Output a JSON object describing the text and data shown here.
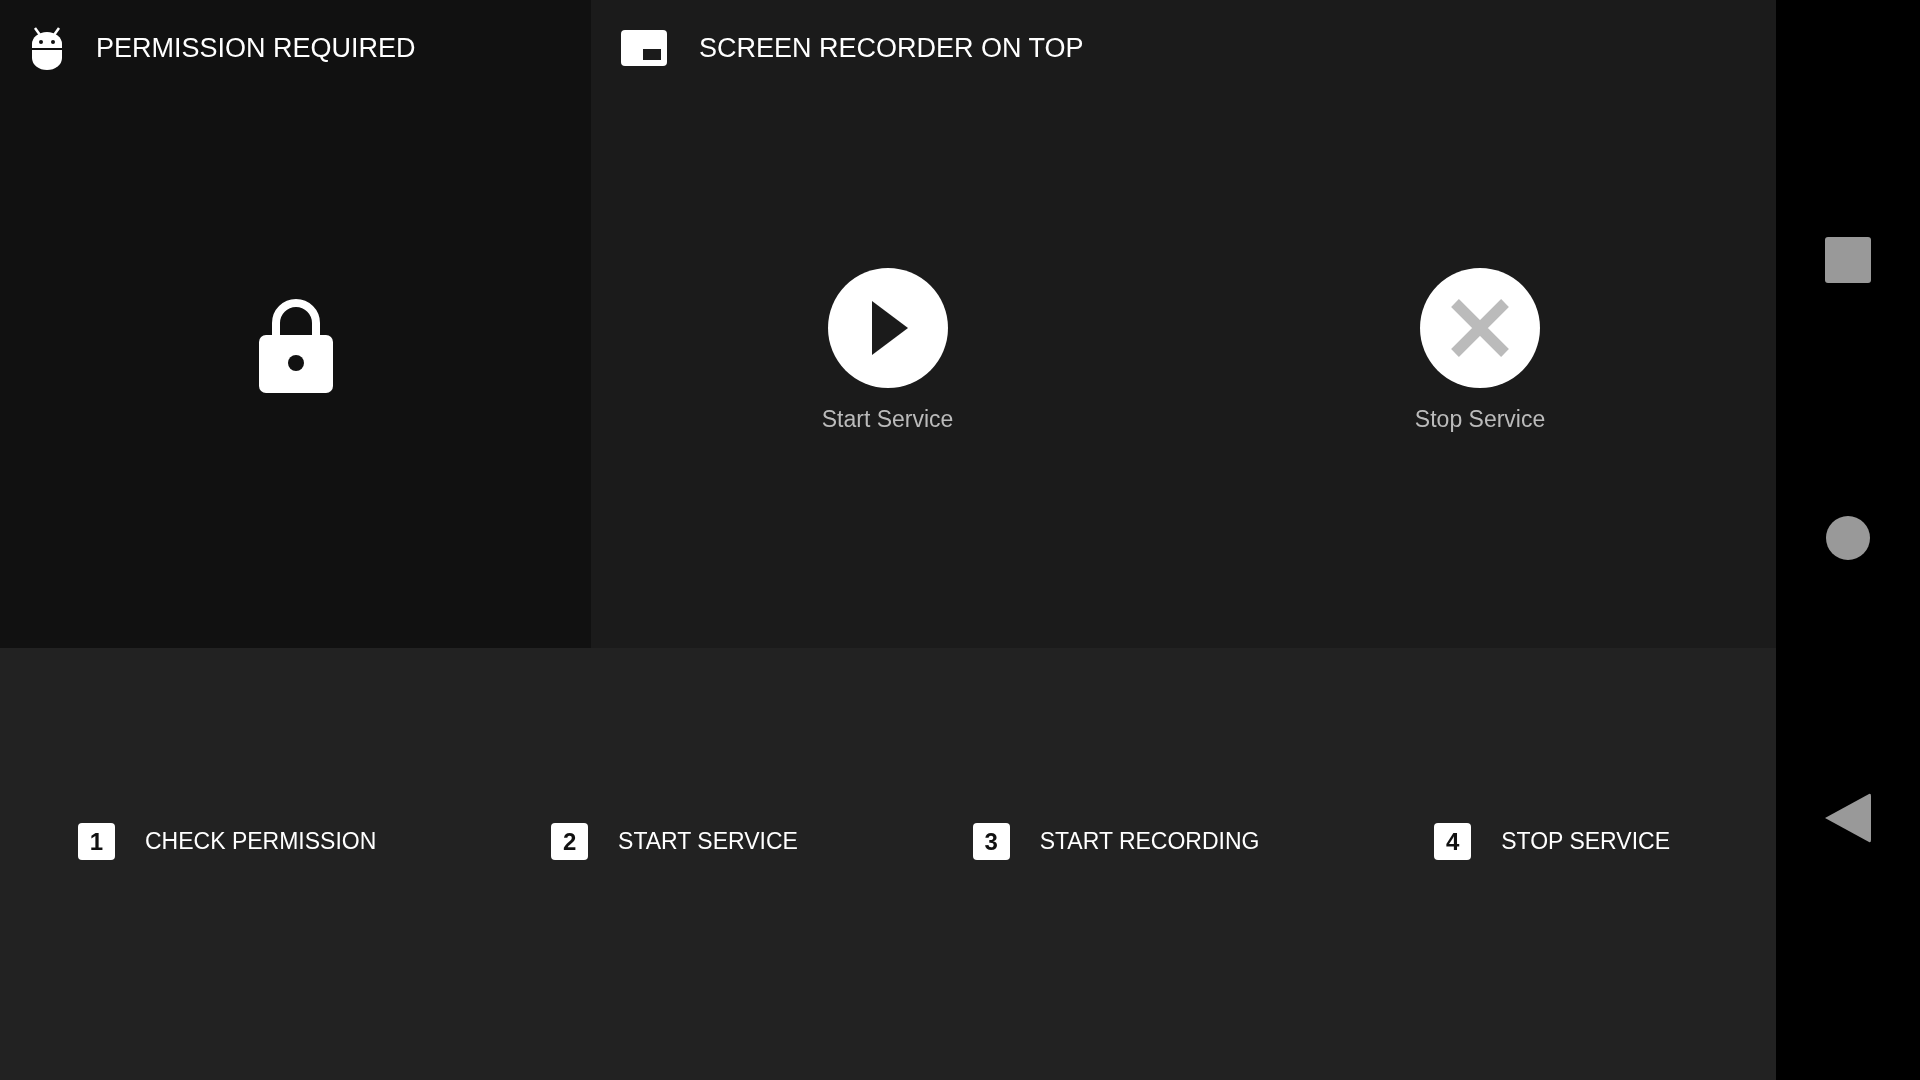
{
  "permission_panel": {
    "title": "PERMISSION REQUIRED",
    "locked": true
  },
  "recorder_panel": {
    "title": "SCREEN RECORDER ON TOP",
    "actions": [
      {
        "kind": "start",
        "label": "Start Service",
        "disabled": false
      },
      {
        "kind": "stop",
        "label": "Stop Service",
        "disabled": true
      }
    ]
  },
  "steps": [
    {
      "number": "1",
      "label": "CHECK PERMISSION"
    },
    {
      "number": "2",
      "label": "START SERVICE"
    },
    {
      "number": "3",
      "label": "START RECORDING"
    },
    {
      "number": "4",
      "label": "STOP SERVICE"
    }
  ]
}
